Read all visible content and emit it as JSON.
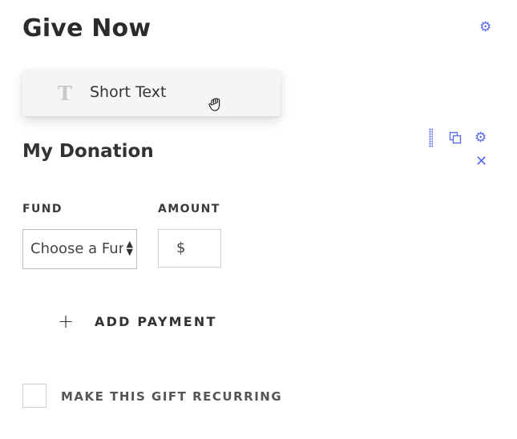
{
  "header": {
    "title": "Give Now",
    "settings_icon": "gear-icon"
  },
  "drag_preview": {
    "label": "Short Text",
    "icon": "text-type-icon",
    "icon_glyph": "T",
    "cursor_icon": "grab-hand-icon"
  },
  "section": {
    "title": "My Donation",
    "tools": [
      "drag-handle-icon",
      "duplicate-icon",
      "gear-icon",
      "close-icon"
    ]
  },
  "fields": {
    "fund": {
      "label": "FUND",
      "selected": "Choose a Fund"
    },
    "amount": {
      "label": "AMOUNT",
      "currency": "$",
      "value": ""
    }
  },
  "add_payment": {
    "plus": "+",
    "label": "ADD PAYMENT"
  },
  "recurring": {
    "label": "MAKE THIS GIFT RECURRING",
    "checked": false
  },
  "colors": {
    "accent": "#5b6cf0",
    "text": "#333333",
    "border": "#bdbdbd"
  }
}
